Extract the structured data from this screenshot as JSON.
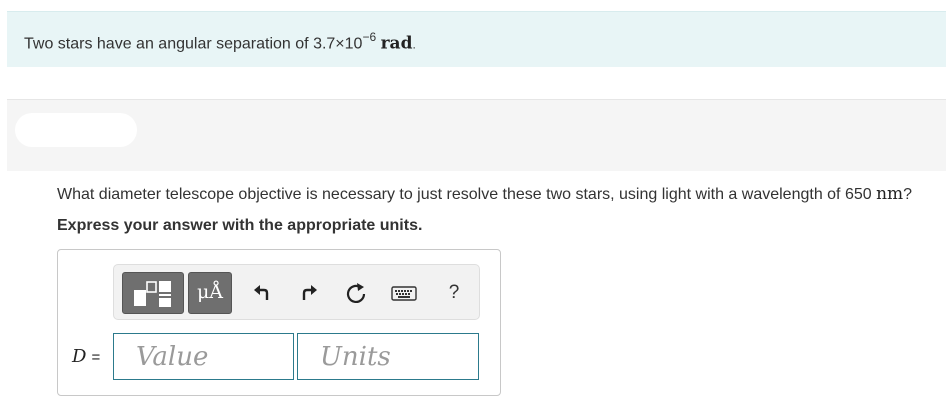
{
  "problem": {
    "text_prefix": "Two stars have an angular separation of 3.7×10",
    "exponent": "−6",
    "unit": "rad",
    "period": "."
  },
  "question": {
    "text": "What diameter telescope objective is necessary to just resolve these two stars, using light with a wavelength of 650 ",
    "unit": "nm",
    "suffix": "?"
  },
  "instruction": "Express your answer with the appropriate units.",
  "answer": {
    "variable": "D",
    "equals": "=",
    "value_placeholder": "Value",
    "units_placeholder": "Units"
  },
  "toolbar": {
    "units_glyph": "μÅ",
    "help_label": "?",
    "icons": [
      "templates-icon",
      "units-icon",
      "undo-icon",
      "redo-icon",
      "reset-icon",
      "keyboard-icon",
      "help-icon"
    ]
  },
  "colors": {
    "banner_bg": "#e8f5f6",
    "field_border": "#2c7a8c",
    "toolbar_button": "#6f6f6f"
  }
}
